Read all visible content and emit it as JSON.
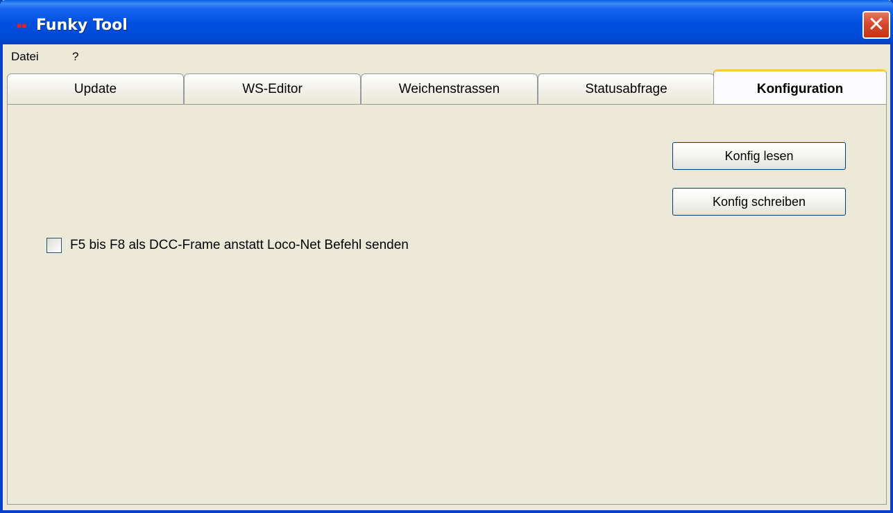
{
  "window": {
    "title": "Funky Tool",
    "close_symbol": "✕"
  },
  "menu": {
    "items": [
      "Datei",
      "?"
    ]
  },
  "tabs": [
    {
      "label": "Update"
    },
    {
      "label": "WS-Editor"
    },
    {
      "label": "Weichenstrassen"
    },
    {
      "label": "Statusabfrage"
    },
    {
      "label": "Konfiguration",
      "active": true
    }
  ],
  "panel": {
    "buttons": {
      "read": "Konfig lesen",
      "write": "Konfig schreiben"
    },
    "checkbox": {
      "label": "F5 bis F8 als DCC-Frame anstatt Loco-Net Befehl senden",
      "checked": false
    }
  },
  "icons": {
    "app": "app-icon",
    "close": "close-icon"
  },
  "colors": {
    "titlebar": "#0050e0",
    "close": "#d6452a",
    "background": "#ece9d8",
    "active_tab_accent": "#ffc83c"
  }
}
